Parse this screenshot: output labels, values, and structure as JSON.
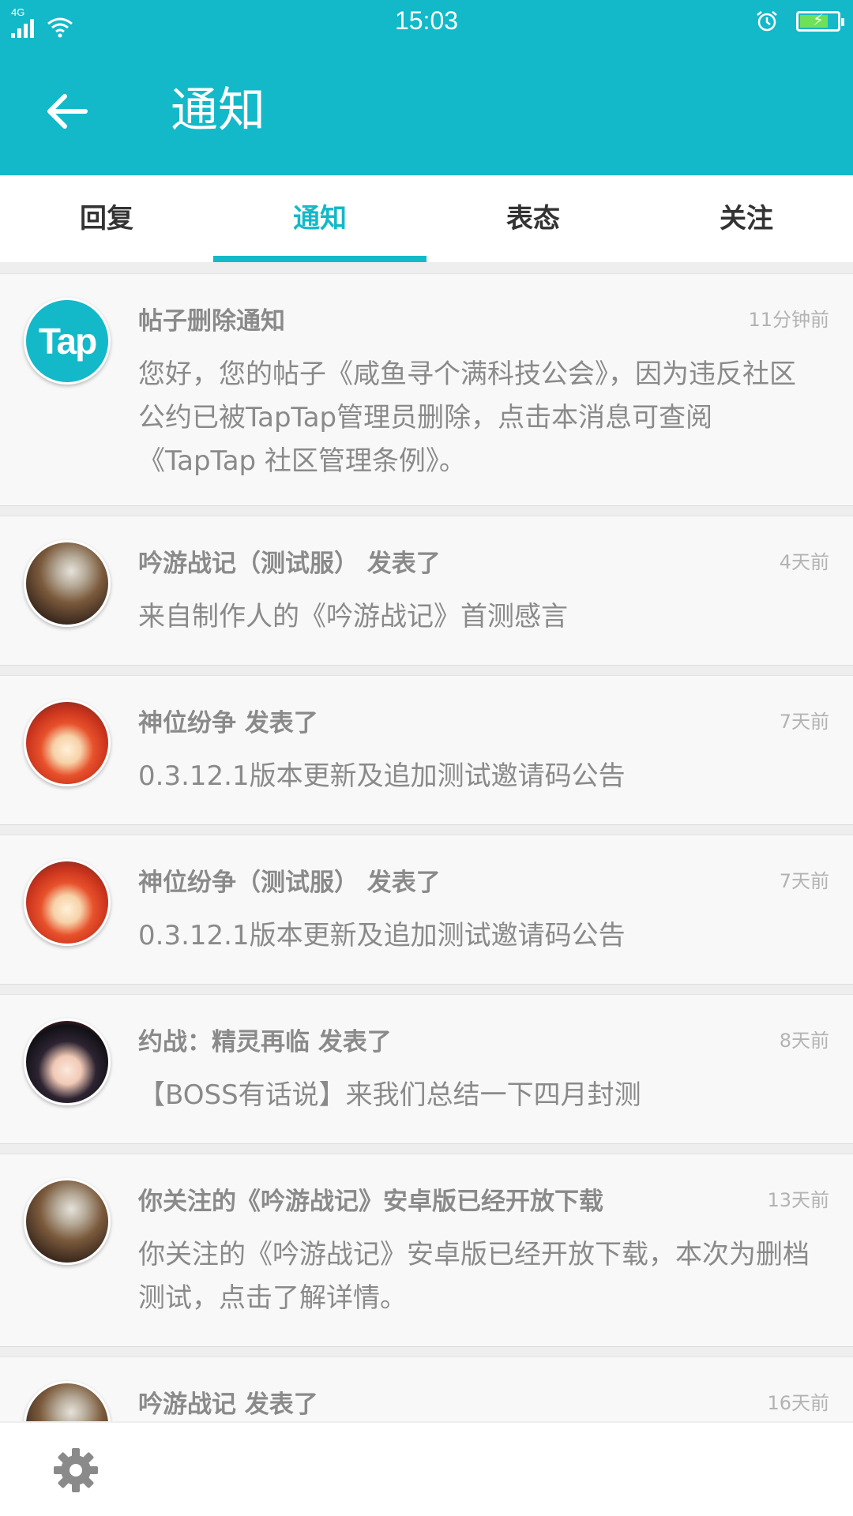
{
  "status_bar": {
    "network": "4G",
    "time": "15:03"
  },
  "header": {
    "title": "通知"
  },
  "tabs": [
    {
      "label": "回复",
      "active": false
    },
    {
      "label": "通知",
      "active": true
    },
    {
      "label": "表态",
      "active": false
    },
    {
      "label": "关注",
      "active": false
    }
  ],
  "notifications": [
    {
      "avatar": "tap-logo",
      "avatar_text": "Tap",
      "title": "帖子删除通知",
      "time": "11分钟前",
      "body": "您好，您的帖子《咸鱼寻个满科技公会》，因为违反社区公约已被TapTap管理员删除，点击本消息可查阅《TapTap 社区管理条例》。"
    },
    {
      "avatar": "knight-avatar",
      "title": "吟游战记（测试服） 发表了",
      "time": "4天前",
      "body": "来自制作人的《吟游战记》首测感言"
    },
    {
      "avatar": "red-hair-avatar",
      "title": "神位纷争 发表了",
      "time": "7天前",
      "body": "0.3.12.1版本更新及追加测试邀请码公告"
    },
    {
      "avatar": "red-hair-avatar",
      "title": "神位纷争（测试服） 发表了",
      "time": "7天前",
      "body": "0.3.12.1版本更新及追加测试邀请码公告"
    },
    {
      "avatar": "dark-hair-avatar",
      "title": "约战：精灵再临 发表了",
      "time": "8天前",
      "body": "【BOSS有话说】来我们总结一下四月封测"
    },
    {
      "avatar": "knight-avatar",
      "title": "你关注的《吟游战记》安卓版已经开放下载",
      "time": "13天前",
      "body": "你关注的《吟游战记》安卓版已经开放下载，本次为删档测试，点击了解详情。"
    },
    {
      "avatar": "knight-avatar",
      "title": "吟游战记 发表了",
      "time": "16天前",
      "body": ""
    }
  ],
  "colors": {
    "accent": "#13b9c8",
    "background": "#eeeeee",
    "card": "#f8f8f8",
    "text_muted": "#8a8a8a",
    "time_text": "#b3b3b3"
  }
}
